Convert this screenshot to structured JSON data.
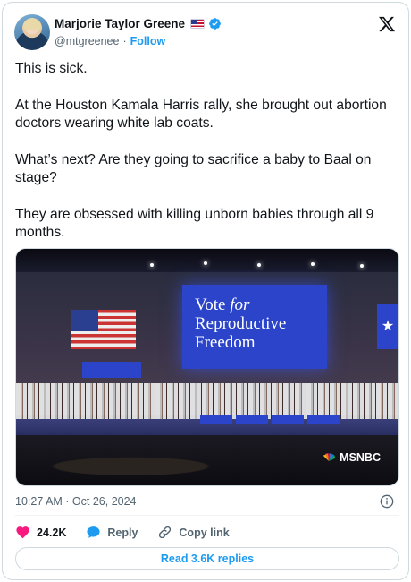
{
  "author": {
    "name": "Marjorie Taylor Greene",
    "handle": "@mtgreenee",
    "separator": "·",
    "follow_label": "Follow"
  },
  "tweet": {
    "paragraphs": [
      "This is sick.",
      "At the Houston Kamala Harris rally, she brought out abortion doctors wearing white lab coats.",
      "What’s next? Are they going to sacrifice a baby to Baal on stage?",
      "They are obsessed with killing unborn babies through all 9 months."
    ]
  },
  "media": {
    "screen_line1": "Vote ",
    "screen_line1_italic": "for",
    "screen_line2": "Reproductive",
    "screen_line3": "Freedom",
    "watermark": "MSNBC",
    "side_screen_glyph": "★"
  },
  "timestamp": "10:27 AM · Oct 26, 2024",
  "actions": {
    "like_count": "24.2K",
    "reply_label": "Reply",
    "copy_label": "Copy link"
  },
  "read_replies_label": "Read 3.6K replies",
  "colors": {
    "accent": "#1d9bf0",
    "like": "#f91880",
    "secondary_text": "#536471"
  },
  "icons": [
    "us-flag-icon",
    "verified-icon",
    "x-logo-icon",
    "info-icon",
    "heart-icon",
    "reply-icon",
    "link-icon",
    "peacock-icon"
  ]
}
